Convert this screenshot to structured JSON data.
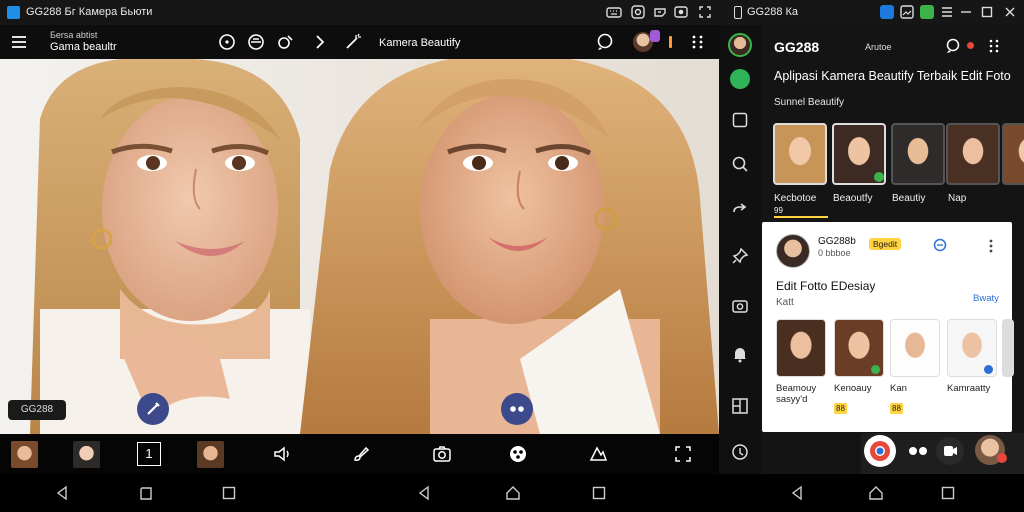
{
  "window": {
    "title": "GG288 Бг Камера Бьюти",
    "right_title": "GG288 Ка"
  },
  "appbar": {
    "subtitle": "Беrsa abtist",
    "title": "Gama beaultr",
    "mode_label": "Kamera Beautify"
  },
  "photo": {
    "watermark": "GG288",
    "reshape_button_icon": "pen-icon",
    "more_button_icon": "dots-icon"
  },
  "tools": {
    "page_indicator": "1"
  },
  "right_panel": {
    "brand": "GG288",
    "brand_sub": "Arutoe",
    "heading": "Aplipasi Kamera Beautify Terbaik Edit Foto",
    "section": "Sunnel Beautify",
    "top_thumbs": [
      {
        "label": "Kecbotoe",
        "sub": "99"
      },
      {
        "label": "Beaoutfy",
        "sub": ""
      },
      {
        "label": "Beautiy",
        "sub": ""
      },
      {
        "label": "Nap",
        "sub": ""
      }
    ],
    "card": {
      "account": "GG288b",
      "account_sub": "0 bbboe",
      "tag": "Bgedit",
      "title": "Edit Fotto EDesiay",
      "subtitle": "Katt",
      "action": "Bwaty",
      "thumbs": [
        {
          "label": "Beamouy",
          "sub": "sasyy'd"
        },
        {
          "label": "Kenoauy",
          "sub": "88"
        },
        {
          "label": "Kan",
          "sub": "88"
        },
        {
          "label": "Kamraatty",
          "sub": ""
        }
      ]
    }
  },
  "colors": {
    "accent_red": "#e8483a",
    "accent_yellow": "#ffd23f",
    "link_blue": "#2b6fd6",
    "button_navy": "#3c4a8c"
  }
}
